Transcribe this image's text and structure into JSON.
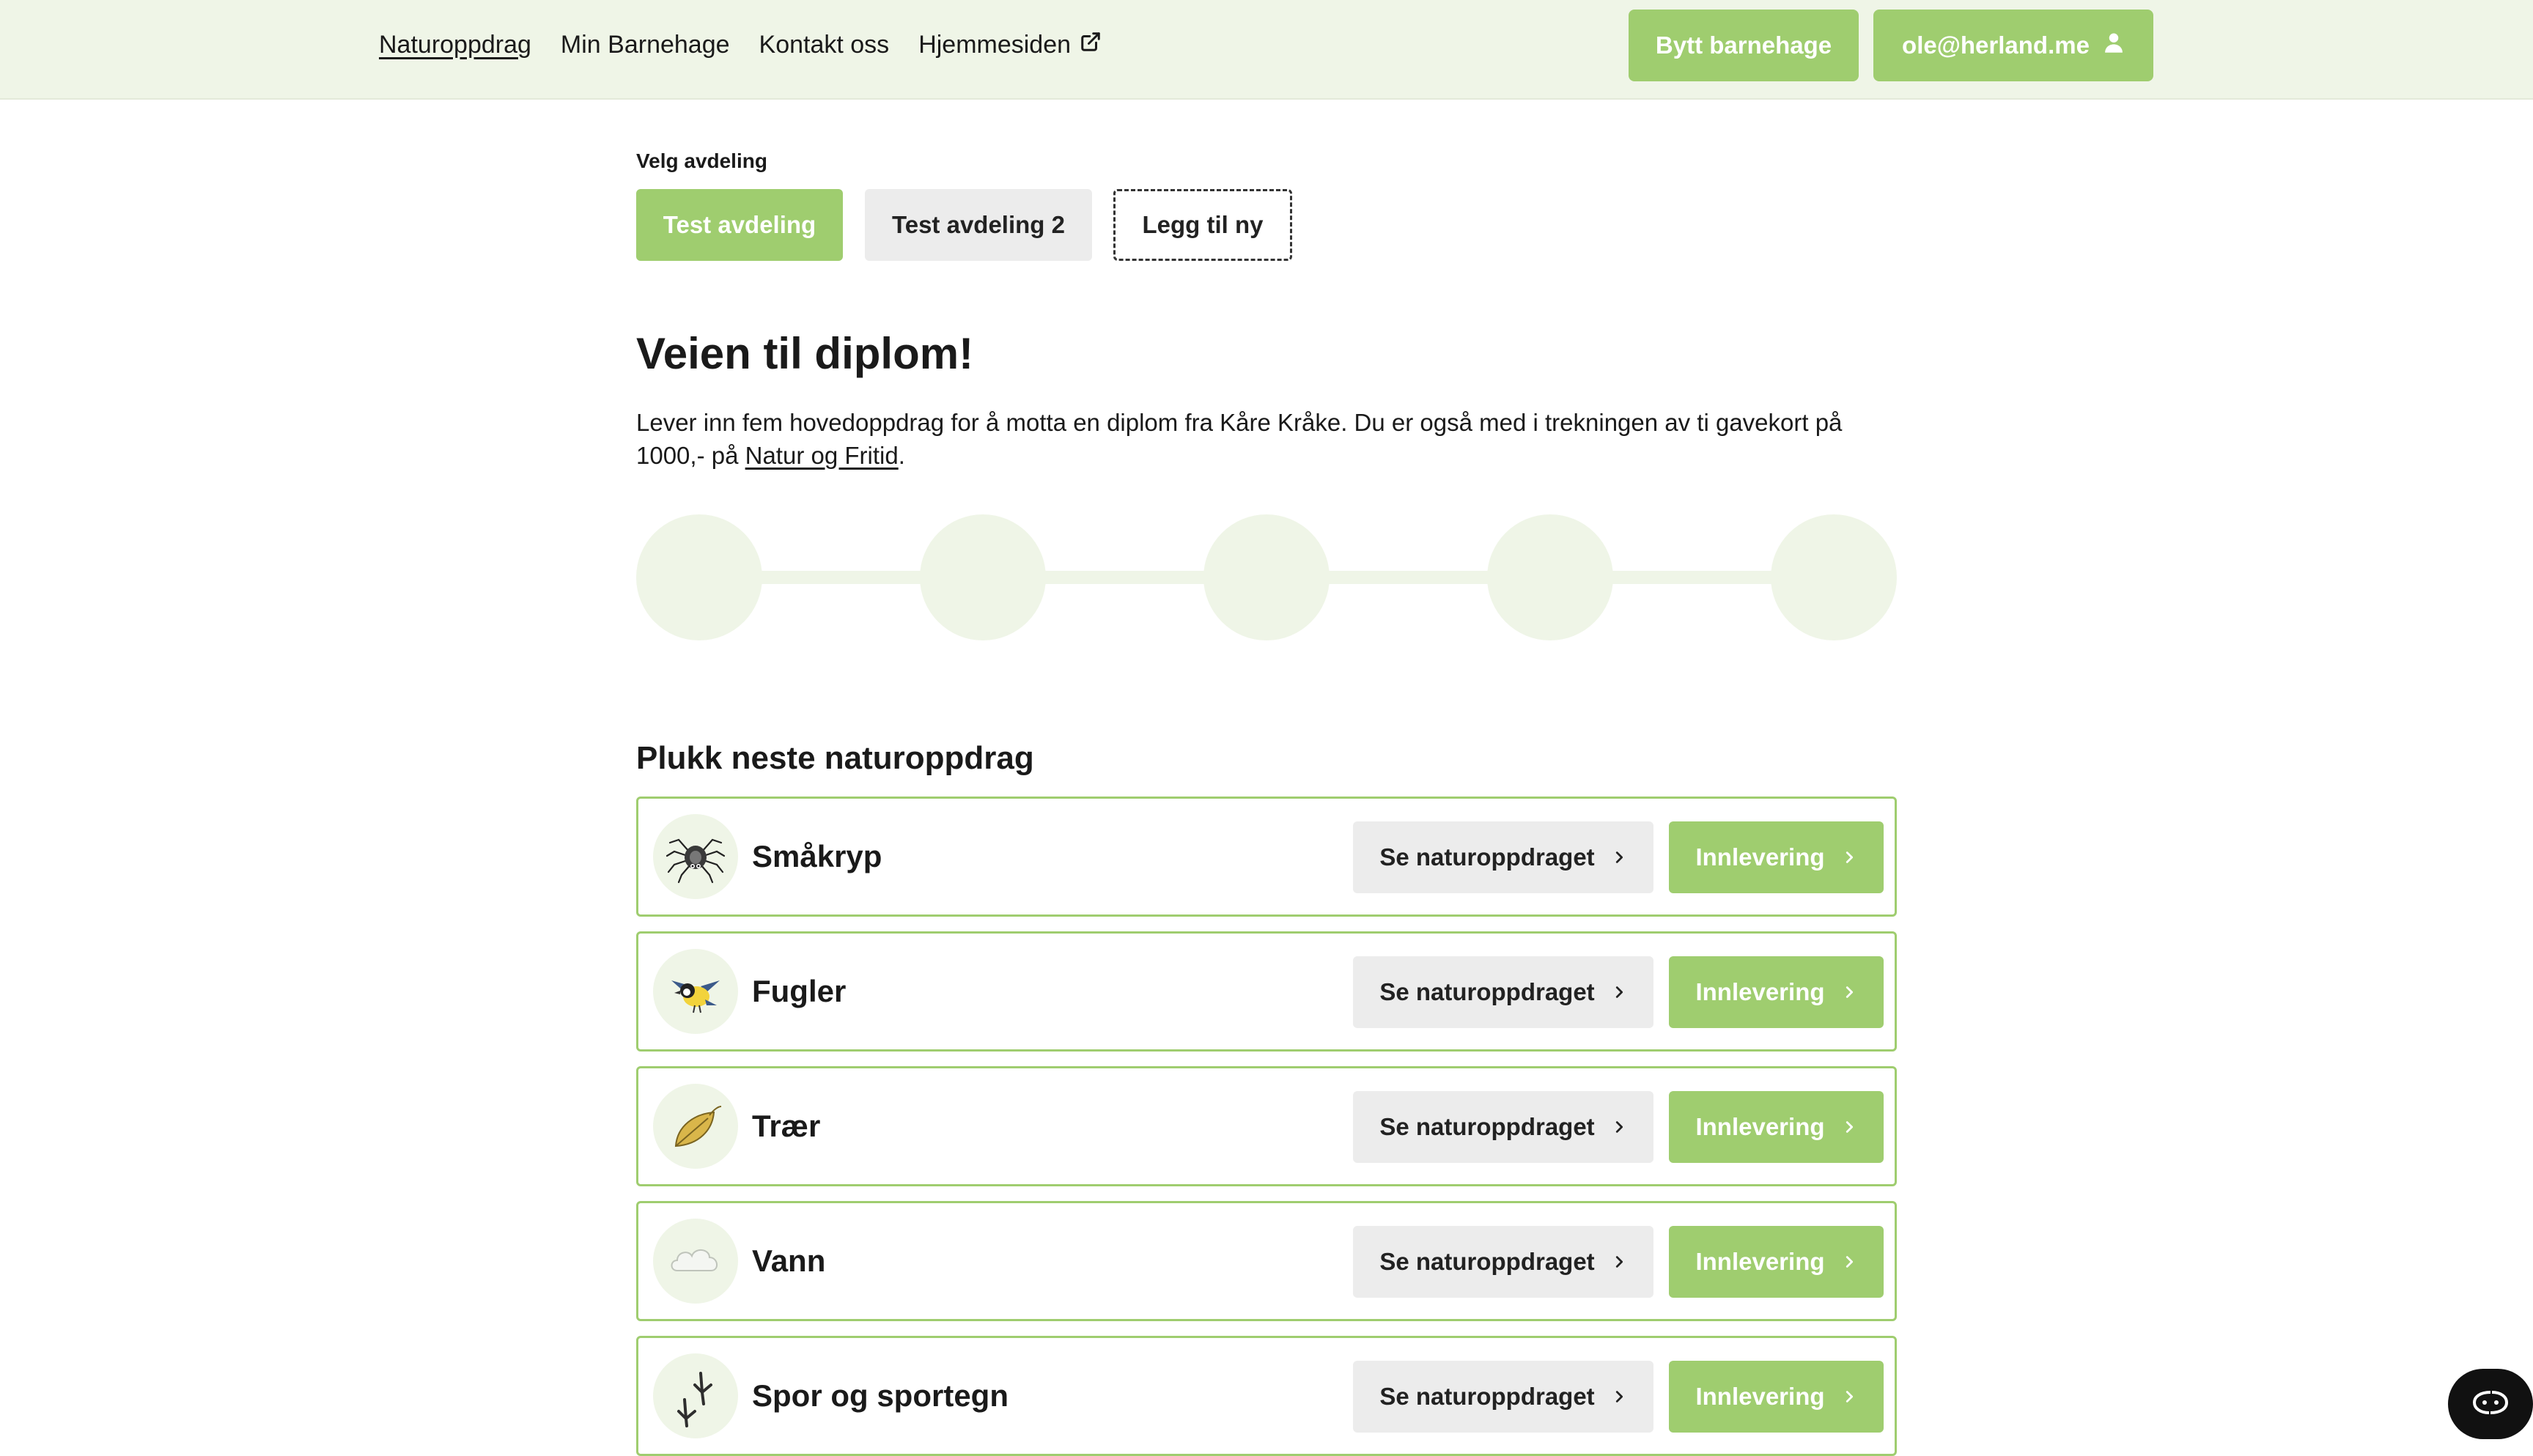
{
  "nav": {
    "items": [
      {
        "label": "Naturoppdrag",
        "active": true
      },
      {
        "label": "Min Barnehage",
        "active": false
      },
      {
        "label": "Kontakt oss",
        "active": false
      },
      {
        "label": "Hjemmesiden",
        "active": false,
        "icon": "external-link-icon"
      }
    ],
    "switch_label": "Bytt barnehage",
    "user_label": "ole@herland.me",
    "user_icon": "user-icon"
  },
  "departments": {
    "label": "Velg avdeling",
    "items": [
      {
        "label": "Test avdeling",
        "selected": true
      },
      {
        "label": "Test avdeling 2",
        "selected": false
      }
    ],
    "add_label": "Legg til ny"
  },
  "diploma": {
    "title": "Veien til diplom!",
    "text_before": "Lever inn fem hovedoppdrag for å motta en diplom fra Kåre Kråke. Du er også med i trekningen av ti gavekort på 1000,- på ",
    "link_text": "Natur og Fritid",
    "text_after": ".",
    "completed_steps": 0,
    "total_steps": 5
  },
  "tasks": {
    "title": "Plukk neste naturoppdrag",
    "see_label": "Se naturoppdraget",
    "submit_label": "Innlevering",
    "items": [
      {
        "name": "Småkryp",
        "icon": "spider-icon"
      },
      {
        "name": "Fugler",
        "icon": "bird-icon"
      },
      {
        "name": "Trær",
        "icon": "leaf-icon"
      },
      {
        "name": "Vann",
        "icon": "cloud-icon"
      },
      {
        "name": "Spor og sportegn",
        "icon": "footprint-icon"
      }
    ]
  },
  "colors": {
    "accent": "#9fcd6f",
    "accent_light": "#eff5e7",
    "button_gray": "#ececec"
  },
  "chat_icon": "chat-widget-icon"
}
